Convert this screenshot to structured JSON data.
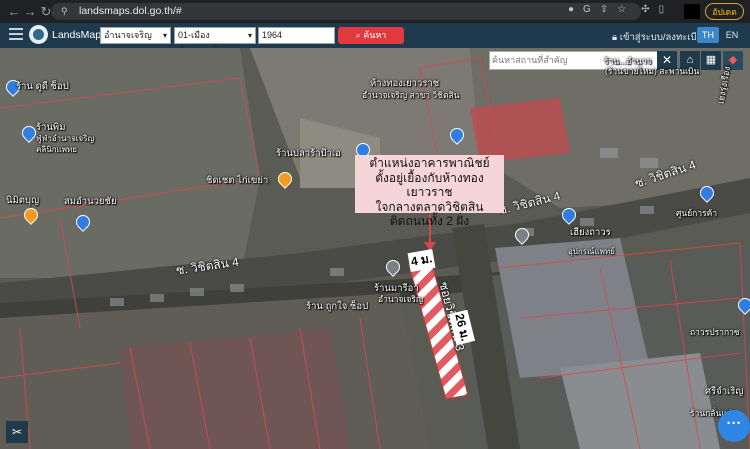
{
  "browser": {
    "url": "landsmaps.dol.go.th/#",
    "update_label": "อัปเดต"
  },
  "header": {
    "app_title": "LandsMaps",
    "province_select": "อำนาจเจริญ",
    "district_select": "01-เมืองอำนาจเจริญ",
    "parcel_input": "1964",
    "search_label": "ค้นหา",
    "login_label": "เข้าสู่ระบบ/ลงทะเบียน",
    "lang_th": "TH",
    "lang_en": "EN"
  },
  "map": {
    "place_search_placeholder": "ค้นหาสถานที่สำคัญ",
    "callout": {
      "line1": "ตำแหน่งอาคารพาณิชย์",
      "line2": "ตั้งอยู่เยื้องกับห้างทองเยาวราช",
      "line3": "ใจกลางตลาดวิชิตสิน",
      "line4": "ติดถนนทั้ง 2 ฝั่ง"
    },
    "roads": {
      "soi_vichitsin4_left": "ซ. วิชิตสิน 4",
      "soi_vichitsin4_mid": "ซ. วิชิตสิน 4",
      "soi_vichitsin4_right": "ซ. วิชิตสิน 4",
      "soi_vichitsin3": "ซอยวิชิตสิน 3"
    },
    "measures": {
      "width": "4 ม.",
      "length": "26 ม."
    },
    "places": {
      "p1": "ร้าน ดูดี ช็อป",
      "p2": "ร้านพิม",
      "p2b": "ฟู่ฟ่าอำนาจเจริญ",
      "p2c": "คลินิกแพทย",
      "p3": "นิมิตบุญ",
      "p4": "สมอำนวยชัย",
      "p5": "ห้างทองเยาวราช",
      "p5b": "อำนาจเจริญ สาขา วิชิตสิน",
      "p6": "ร้านปลาร้าป้าเอ",
      "p7": "ชิดเชต ไก่เขย่า",
      "p8": "ร้านมารีอา",
      "p8b": "อำนาจเจริญ",
      "p9": "ร้าน ถูกใจ ช็อป",
      "p10": "เฮงรุ่งเรือง",
      "p11": "ศูนย์การค้า",
      "p12": "เฮียงถาวร",
      "p12b": "อุปกรณ์แพทย์",
      "p13": "ถาวรปรากาซ",
      "p14": "ศรีจำเริญ",
      "p15": "ร้านกลั่นแจ่ม",
      "top_right": "(ร้านขายไหม) สะพานเบิน",
      "top_right2": "ร้าน...อำนาจ"
    },
    "colors": {
      "header_bg": "#1e3a4c",
      "search_btn": "#e03a3e",
      "lang_active": "#3a86c8",
      "parcel_line": "#d8474f",
      "callout_bg": "#f6d5d8",
      "fab": "#2f86e4"
    }
  }
}
